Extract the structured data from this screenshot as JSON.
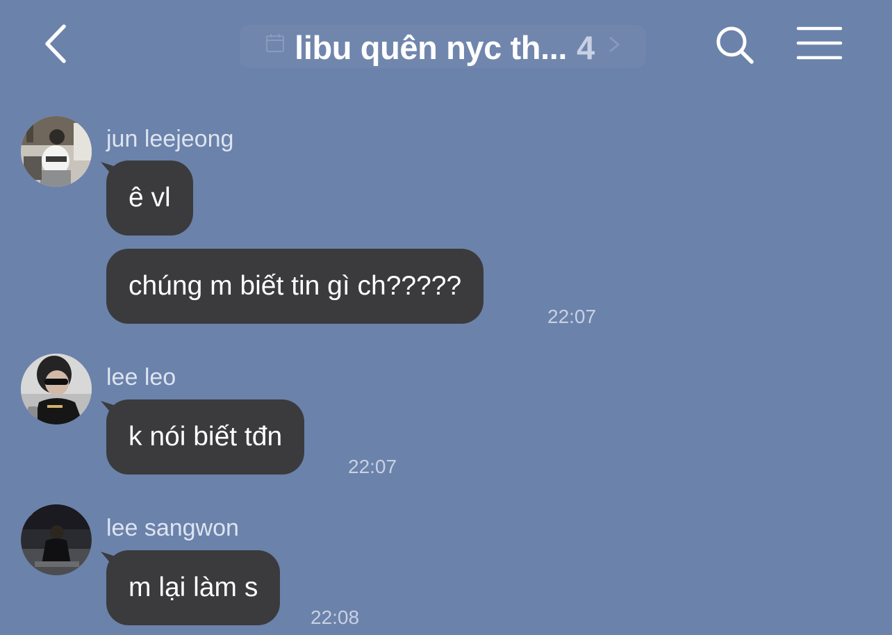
{
  "chat": {
    "title": "libu quên nyc th...",
    "member_count": "4"
  },
  "icons": {
    "back": "chevron-left-icon",
    "search": "search-icon",
    "menu": "hamburger-menu-icon"
  },
  "colors": {
    "background": "#6b82ab",
    "bubble": "#3b3b3d",
    "text": "#ffffff",
    "secondary_text": "#dde4ef"
  },
  "messages": [
    {
      "sender": "jun leejeong",
      "bubbles": [
        {
          "text": "ê vl"
        },
        {
          "text": "chúng m biết tin gì ch?????",
          "time": "22:07"
        }
      ]
    },
    {
      "sender": "lee leo",
      "bubbles": [
        {
          "text": "k nói biết tđn",
          "time": "22:07"
        }
      ]
    },
    {
      "sender": "lee sangwon",
      "bubbles": [
        {
          "text": "m lại làm s",
          "time": "22:08"
        }
      ]
    }
  ]
}
